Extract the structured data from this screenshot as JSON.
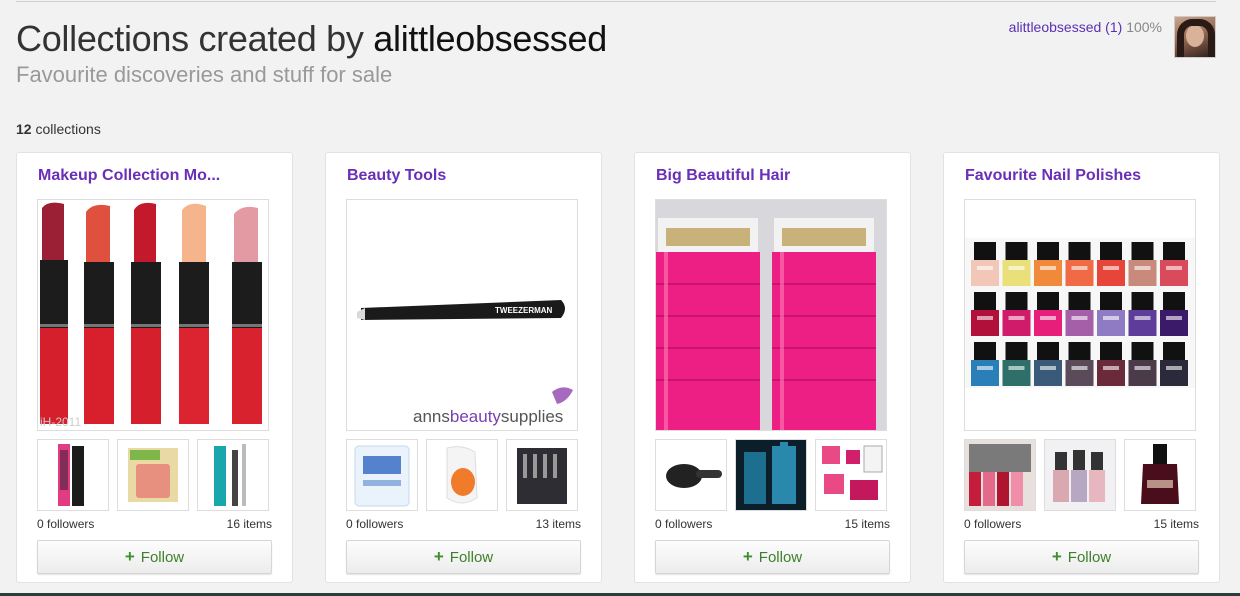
{
  "page": {
    "title_prefix": "Collections created by",
    "owner": "alittleobsessed",
    "subtitle": "Favourite discoveries and stuff for sale"
  },
  "user": {
    "name": "alittleobsessed",
    "count": "(1)",
    "percent": "100%"
  },
  "collections_count": {
    "number": "12",
    "label": "collections"
  },
  "cards": [
    {
      "title": "Makeup Collection Mo...",
      "followers": "0 followers",
      "items": "16 items",
      "follow_label": "Follow",
      "image_caption": "iH-2011"
    },
    {
      "title": "Beauty Tools",
      "followers": "0 followers",
      "items": "13 items",
      "follow_label": "Follow",
      "watermark_prefix": "anns",
      "watermark_bold": "beauty",
      "watermark_suffix": "supplies",
      "tweezer_brand": "TWEEZERMAN"
    },
    {
      "title": "Big Beautiful Hair",
      "followers": "0 followers",
      "items": "15 items",
      "follow_label": "Follow"
    },
    {
      "title": "Favourite Nail Polishes",
      "followers": "0 followers",
      "items": "15 items",
      "follow_label": "Follow"
    }
  ]
}
